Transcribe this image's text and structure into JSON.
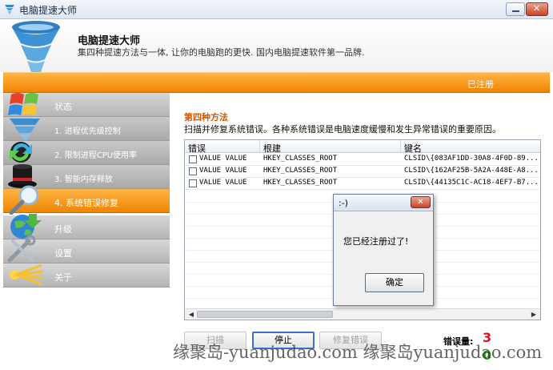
{
  "window": {
    "title": "电脑提速大师"
  },
  "header": {
    "app_name": "电脑提速大师",
    "slogan": "集四种提速方法与一体, 让你的电脑跑的更快. 国内电脑提速软件第一品牌."
  },
  "status_bar": {
    "registered": "已注册"
  },
  "sidebar": {
    "items": [
      {
        "label": "状态",
        "icon": "windows-logo-icon"
      },
      {
        "label": "1. 进程优先级控制",
        "icon": "tornado-icon"
      },
      {
        "label": "2. 限制进程CPU使用率",
        "icon": "refresh-arrows-icon"
      },
      {
        "label": "3. 智能内存释放",
        "icon": "magic-hat-icon"
      },
      {
        "label": "4. 系统错误修复",
        "icon": "magnifier-icon",
        "active": true
      },
      {
        "label": "升级",
        "icon": "globe-icon"
      },
      {
        "label": "设置",
        "icon": "tools-icon"
      },
      {
        "label": "关于",
        "icon": "light-rays-icon"
      }
    ]
  },
  "main": {
    "section_title": "第四种方法",
    "section_desc": "扫描并修复系统错误。各种系统错误是电脑速度缓慢和发生异常错误的重要原因。",
    "columns": [
      "错误",
      "根建",
      "键名"
    ],
    "rows": [
      {
        "error": "VALUE VALUE",
        "root": "HKEY_CLASSES_ROOT",
        "key": "CLSID\\{083AF1DD-30A8-4F0D-89..."
      },
      {
        "error": "VALUE VALUE",
        "root": "HKEY_CLASSES_ROOT",
        "key": "CLSID\\{162AF25B-5A2A-448E-A8..."
      },
      {
        "error": "VALUE VALUE",
        "root": "HKEY_CLASSES_ROOT",
        "key": "CLSID\\{44135C1C-AC18-4EF7-B7..."
      }
    ],
    "buttons": {
      "scan": "扫描",
      "stop": "停止",
      "fix": "修复错误"
    },
    "error_count_label": "错误量:",
    "error_count": "3",
    "fixed_count": "0"
  },
  "dialog": {
    "title": ":-)",
    "message": "您已经注册过了!",
    "ok_label": "确定"
  },
  "watermark": "缘聚岛-yuanjudao.com   缘聚岛yuanjudao.com"
}
